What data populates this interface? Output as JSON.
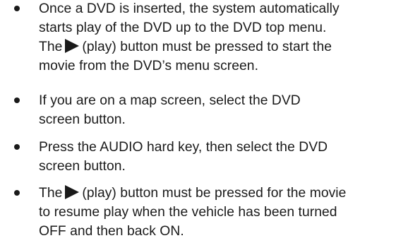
{
  "bullets": [
    {
      "lines": [
        "Once a DVD is inserted, the system automatically",
        "starts play of the DVD up to the DVD top menu.",
        {
          "before": "The",
          "icon": "play-icon",
          "after": "(play) button must be pressed to start the"
        },
        "movie from the DVD’s menu screen."
      ]
    },
    {
      "lines": [
        "If you are on a map screen, select the DVD",
        "screen button."
      ]
    },
    {
      "lines": [
        "Press the AUDIO hard key, then select the DVD",
        "screen button."
      ]
    },
    {
      "lines": [
        {
          "before": "The",
          "icon": "play-icon",
          "after": "(play) button must be pressed for the movie"
        },
        "to resume play when the vehicle has been turned",
        "OFF and then back ON."
      ]
    }
  ]
}
